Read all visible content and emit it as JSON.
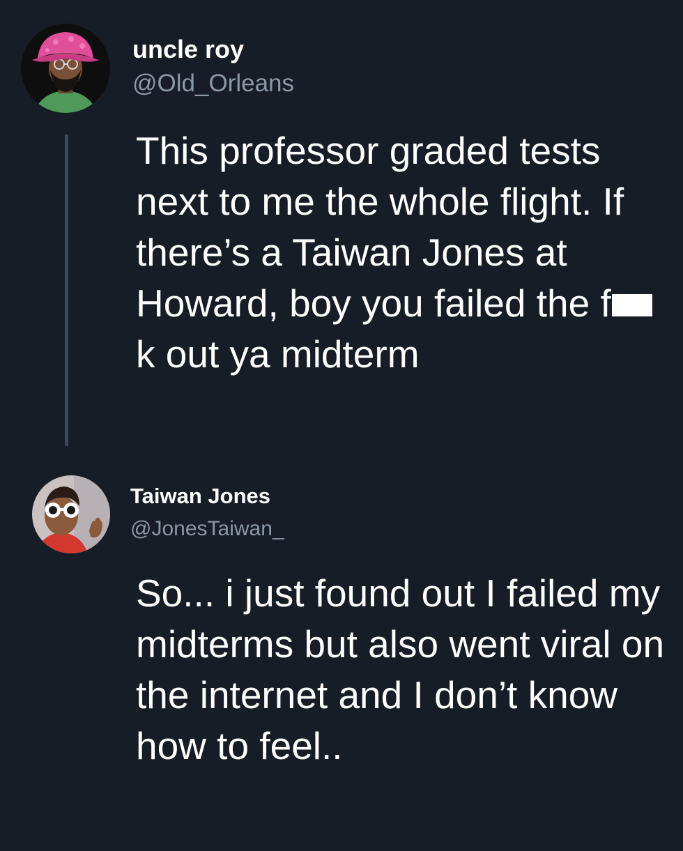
{
  "tweets": [
    {
      "display_name": "uncle roy",
      "handle": "@Old_Orleans",
      "avatar_icon": "avatar-man-pink-hat",
      "text_before": "This professor graded tests next to me the whole flight. If there’s a Taiwan Jones at Howard, boy you failed the f",
      "text_after": "k out ya midterm"
    },
    {
      "display_name": "Taiwan Jones",
      "handle": "@JonesTaiwan_",
      "avatar_icon": "avatar-person-white-sunglasses",
      "text": "So... i just found out I failed my midterms but also went viral on the internet and I don’t know how to feel.."
    }
  ],
  "colors": {
    "background": "#161d27",
    "handle": "#8b98a5",
    "thread_line": "#3d4a57",
    "text": "#ffffff"
  }
}
